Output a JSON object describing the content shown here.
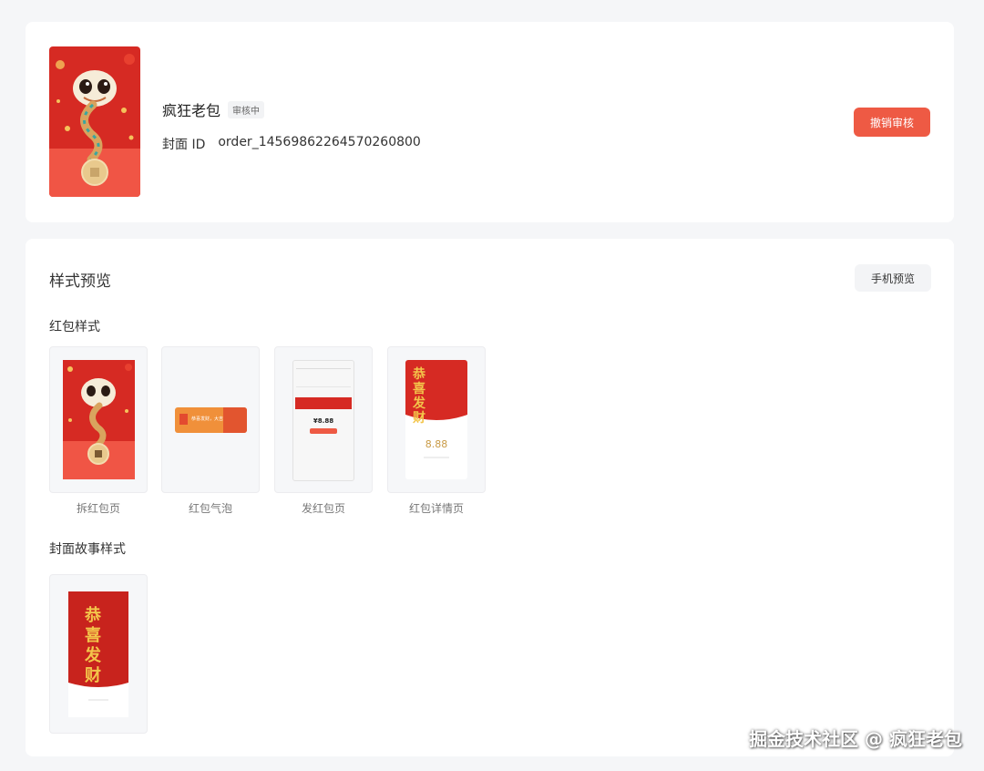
{
  "header": {
    "cover_name": "疯狂老包",
    "status": "审核中",
    "id_label": "封面 ID",
    "id_value": "order_14569862264570260800",
    "cancel_label": "撤销审核"
  },
  "preview": {
    "title": "样式预览",
    "phone_preview_label": "手机预览",
    "envelope_group_title": "红包样式",
    "envelope_styles": [
      {
        "label": "拆红包页"
      },
      {
        "label": "红包气泡"
      },
      {
        "label": "发红包页"
      },
      {
        "label": "红包详情页"
      }
    ],
    "story_group_title": "封面故事样式",
    "amount_text": "¥8.88",
    "detail_amount": "8.88",
    "banner_text": "恭喜发财",
    "bubble_text": "恭喜发财，大吉大利"
  },
  "watermark": "掘金技术社区 @ 疯狂老包",
  "colors": {
    "accent": "#ee5a44",
    "envelope_red": "#d62a23",
    "gold": "#e9c98d"
  }
}
